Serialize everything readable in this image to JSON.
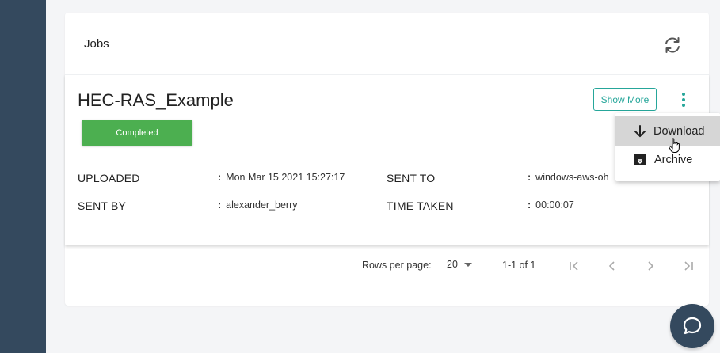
{
  "panel": {
    "title": "Jobs"
  },
  "job": {
    "name": "HEC-RAS_Example",
    "status": "Completed",
    "show_more_label": "Show More",
    "fields": {
      "uploaded_label": "UPLOADED",
      "uploaded_value": "Mon Mar 15 2021 15:27:17",
      "sent_to_label": "SENT TO",
      "sent_to_value": "windows-aws-oh",
      "sent_by_label": "SENT BY",
      "sent_by_value": "alexander_berry",
      "time_taken_label": "TIME TAKEN",
      "time_taken_value": "00:00:07"
    }
  },
  "pagination": {
    "rows_label": "Rows per page:",
    "rows_value": "20",
    "range": "1-1 of 1"
  },
  "menu": {
    "items": [
      {
        "label": "Download",
        "icon": "arrow-down-icon",
        "active": true
      },
      {
        "label": "Archive",
        "icon": "archive-box-icon",
        "active": false
      }
    ]
  },
  "colors": {
    "sidebar": "#34495e",
    "accent": "#26a69a",
    "status_completed": "#4caf50"
  }
}
